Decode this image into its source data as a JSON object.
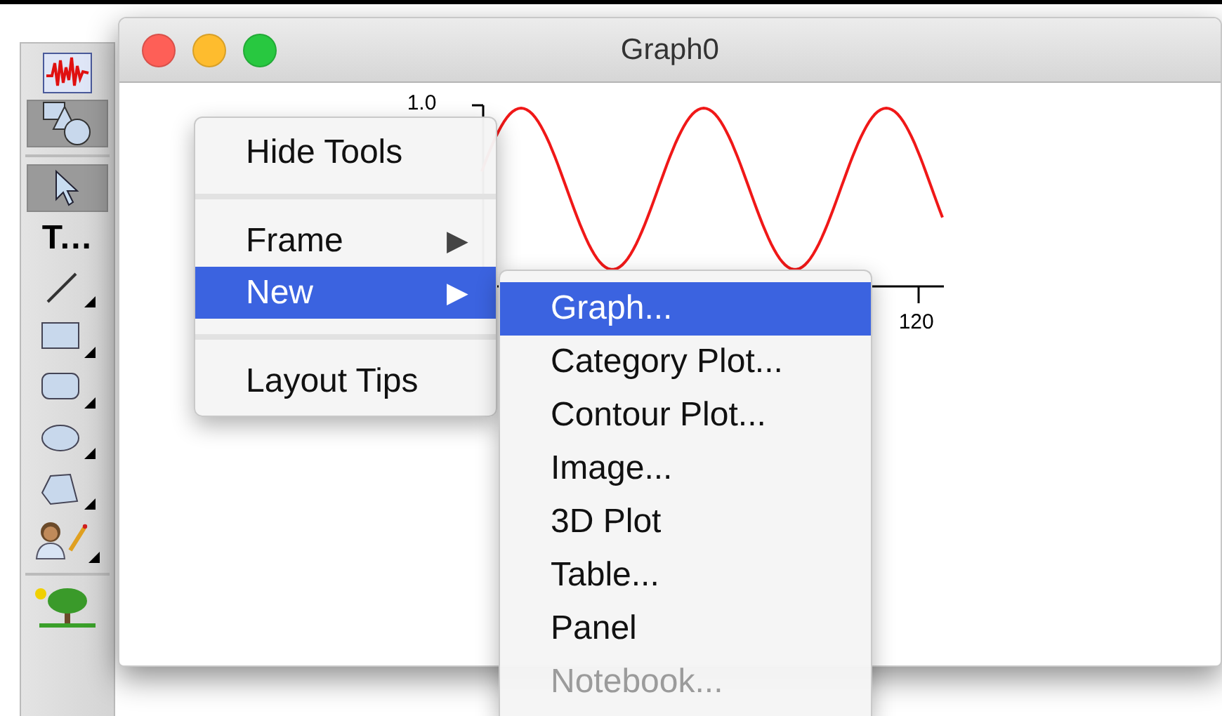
{
  "palette": {
    "top": [
      {
        "kind": "graph",
        "selected": false
      },
      {
        "kind": "shapes",
        "selected": true
      }
    ],
    "tools": [
      {
        "kind": "arrow",
        "selected": true
      },
      {
        "kind": "text",
        "label": "T...",
        "selected": false
      },
      {
        "kind": "line",
        "selected": false
      },
      {
        "kind": "rect",
        "selected": false
      },
      {
        "kind": "roundrect",
        "selected": false
      },
      {
        "kind": "oval",
        "selected": false
      },
      {
        "kind": "polygon",
        "selected": false
      },
      {
        "kind": "picture",
        "selected": false
      }
    ],
    "bottom": [
      {
        "kind": "tree",
        "selected": false
      }
    ]
  },
  "window": {
    "title": "Graph0",
    "buttons": [
      {
        "color": "#fe5f57"
      },
      {
        "color": "#febc2e"
      },
      {
        "color": "#28c840"
      }
    ]
  },
  "graph": {
    "y_tick_label": "1.0",
    "x_tick_label": "120"
  },
  "context_menu": {
    "items": [
      {
        "kind": "item",
        "label": "Hide Tools",
        "selected": false
      },
      {
        "kind": "separator"
      },
      {
        "kind": "submenu",
        "label": "Frame",
        "arrow": "▶",
        "selected": false
      },
      {
        "kind": "submenu",
        "label": "New",
        "arrow": "▶",
        "selected": true
      },
      {
        "kind": "separator"
      },
      {
        "kind": "item",
        "label": "Layout Tips",
        "selected": false
      }
    ]
  },
  "submenu": {
    "items": [
      {
        "label": "Graph...",
        "selected": true,
        "disabled": false
      },
      {
        "label": "Category Plot...",
        "selected": false,
        "disabled": false
      },
      {
        "label": "Contour Plot...",
        "selected": false,
        "disabled": false
      },
      {
        "label": "Image...",
        "selected": false,
        "disabled": false
      },
      {
        "label": "3D Plot",
        "selected": false,
        "disabled": false
      },
      {
        "label": "Table...",
        "selected": false,
        "disabled": false
      },
      {
        "label": "Panel",
        "selected": false,
        "disabled": false
      },
      {
        "label": "Notebook...",
        "selected": false,
        "disabled": true
      }
    ]
  }
}
